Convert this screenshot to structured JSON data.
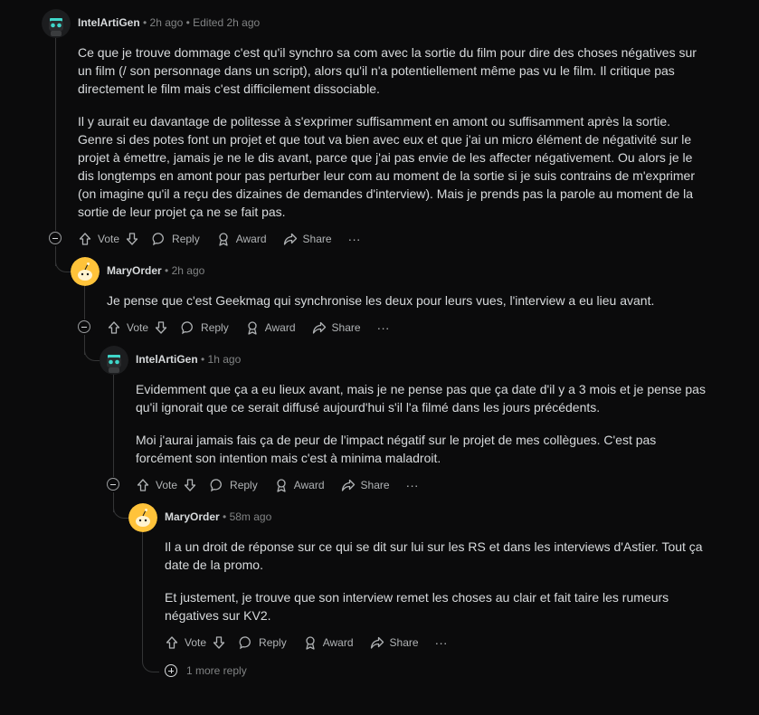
{
  "comments": [
    {
      "author": "IntelArtiGen",
      "meta": "• 2h ago • Edited 2h ago",
      "avatar": "robot-avatar",
      "paragraphs": [
        "Ce que je trouve dommage c'est qu'il synchro sa com avec la sortie du film pour dire des choses négatives sur un film (/ son personnage dans un script), alors qu'il n'a potentiellement même pas vu le film. Il critique pas directement le film mais c'est difficilement dissociable.",
        "Il y aurait eu davantage de politesse à s'exprimer suffisamment en amont ou suffisamment après la sortie. Genre si des potes font un projet et que tout va bien avec eux et que j'ai un micro élément de négativité sur le projet à émettre, jamais je ne le dis avant, parce que j'ai pas envie de les affecter négativement. Ou alors je le dis longtemps en amont pour pas perturber leur com au moment de la sortie si je suis contrains de m'exprimer (on imagine qu'il a reçu des dizaines de demandes d'interview). Mais je prends pas la parole au moment de la sortie de leur projet ça ne se fait pas."
      ]
    },
    {
      "author": "MaryOrder",
      "meta": "• 2h ago",
      "avatar": "snoo-avatar",
      "paragraphs": [
        "Je pense que c'est Geekmag qui synchronise les deux pour leurs vues, l'interview a eu lieu avant."
      ]
    },
    {
      "author": "IntelArtiGen",
      "meta": "• 1h ago",
      "avatar": "robot-avatar",
      "paragraphs": [
        "Evidemment que ça a eu lieux avant, mais je ne pense pas que ça date d'il y a 3 mois et je pense pas qu'il ignorait que ce serait diffusé aujourd'hui s'il l'a filmé dans les jours précédents.",
        "Moi j'aurai jamais fais ça de peur de l'impact négatif sur le projet de mes collègues. C'est pas forcément son intention mais c'est à minima maladroit."
      ]
    },
    {
      "author": "MaryOrder",
      "meta": "• 58m ago",
      "avatar": "snoo-avatar",
      "paragraphs": [
        "Il a un droit de réponse sur ce qui se dit sur lui sur les RS et dans les interviews d'Astier. Tout ça date de la promo.",
        "Et justement, je trouve que son interview remet les choses au clair et fait taire les rumeurs négatives sur KV2."
      ]
    }
  ],
  "actions": {
    "vote": "Vote",
    "reply": "Reply",
    "award": "Award",
    "share": "Share",
    "more": "···"
  },
  "more_replies": "1 more reply",
  "colors": {
    "background": "#0b0b0c",
    "text": "#d7dadc",
    "meta": "#818384",
    "thread_line": "#343536",
    "snoo_yellow": "#ffc33a",
    "robot_teal": "#3fd6c9"
  }
}
